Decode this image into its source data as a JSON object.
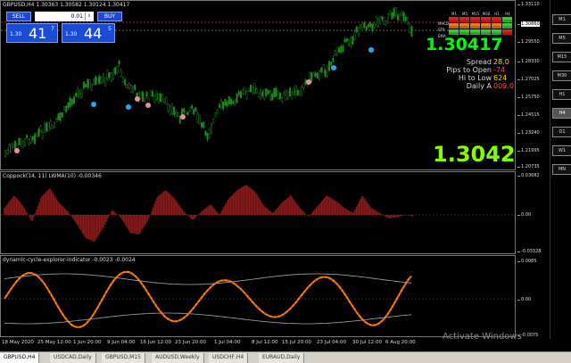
{
  "chart_header": "GBPUSD,H4  1.30363 1.30582 1.30124 1.30417",
  "trade_panel": {
    "sell_label": "SELL",
    "buy_label": "BUY",
    "lot_value": "0.01",
    "sell_small": "1.30",
    "sell_big": "41",
    "sell_sup": "7",
    "buy_small": "1.30",
    "buy_big": "44",
    "buy_sup": "5"
  },
  "dashboard": {
    "timeframes": [
      "M1",
      "M5",
      "M15",
      "M30",
      "H1",
      "H4"
    ],
    "rows": [
      "MACD",
      "STR",
      "EMA"
    ],
    "colors": {
      "green": "#33cc33",
      "red": "#e02020",
      "orange": "#e87a1a"
    }
  },
  "current_price": "1.30417",
  "stats": [
    {
      "label": "Spread",
      "value": "28.0",
      "color": "#ffd700"
    },
    {
      "label": "Pips to Open",
      "value": "-74",
      "color": "#ff4d4d"
    },
    {
      "label": "Hi to Low",
      "value": "624",
      "color": "#ffd700"
    },
    {
      "label": "Daily A",
      "value": "009.0",
      "color": "#ff4d4d"
    }
  ],
  "big_price": "1.3042",
  "price_scale": [
    "1.33110",
    "1.30860",
    "1.29550",
    "1.28330",
    "1.27025",
    "1.25750",
    "1.24515",
    "1.23240",
    "1.21995",
    "1.20735"
  ],
  "coppock": {
    "header": "Coppock(14, 11) LWMA(10) -0.00346",
    "scale": [
      "0.03682",
      "0.00",
      "-0.03328"
    ]
  },
  "cycle": {
    "header": "dynamic-cycle-explorer-indicator -0.0023 -0.0024",
    "scale": [
      "0.0085",
      "0.00",
      "-0.0075"
    ]
  },
  "x_axis": [
    "18 May 2020",
    "25 May 12:00",
    "1 Jun 20:00",
    "9 Jun 04:00",
    "16 Jun 12:00",
    "23 Jun 20:00",
    "1 Jul 04:00",
    "8 Jul 12:00",
    "15 Jul 20:00",
    "23 Jul 04:00",
    "30 Jul 12:00",
    "6 Aug 20:00"
  ],
  "tabs": [
    "GBPUSD,H4",
    "USDCAD,Daily",
    "GBPUSD,M15",
    "AUDUSD,Weekly",
    "USDCHF,H4",
    "EURAUD,Daily"
  ],
  "right_timeframes": [
    "M1",
    "M5",
    "M15",
    "M30",
    "H1",
    "H4",
    "D1",
    "W1",
    "MN"
  ],
  "watermark": "Activate Windows"
}
